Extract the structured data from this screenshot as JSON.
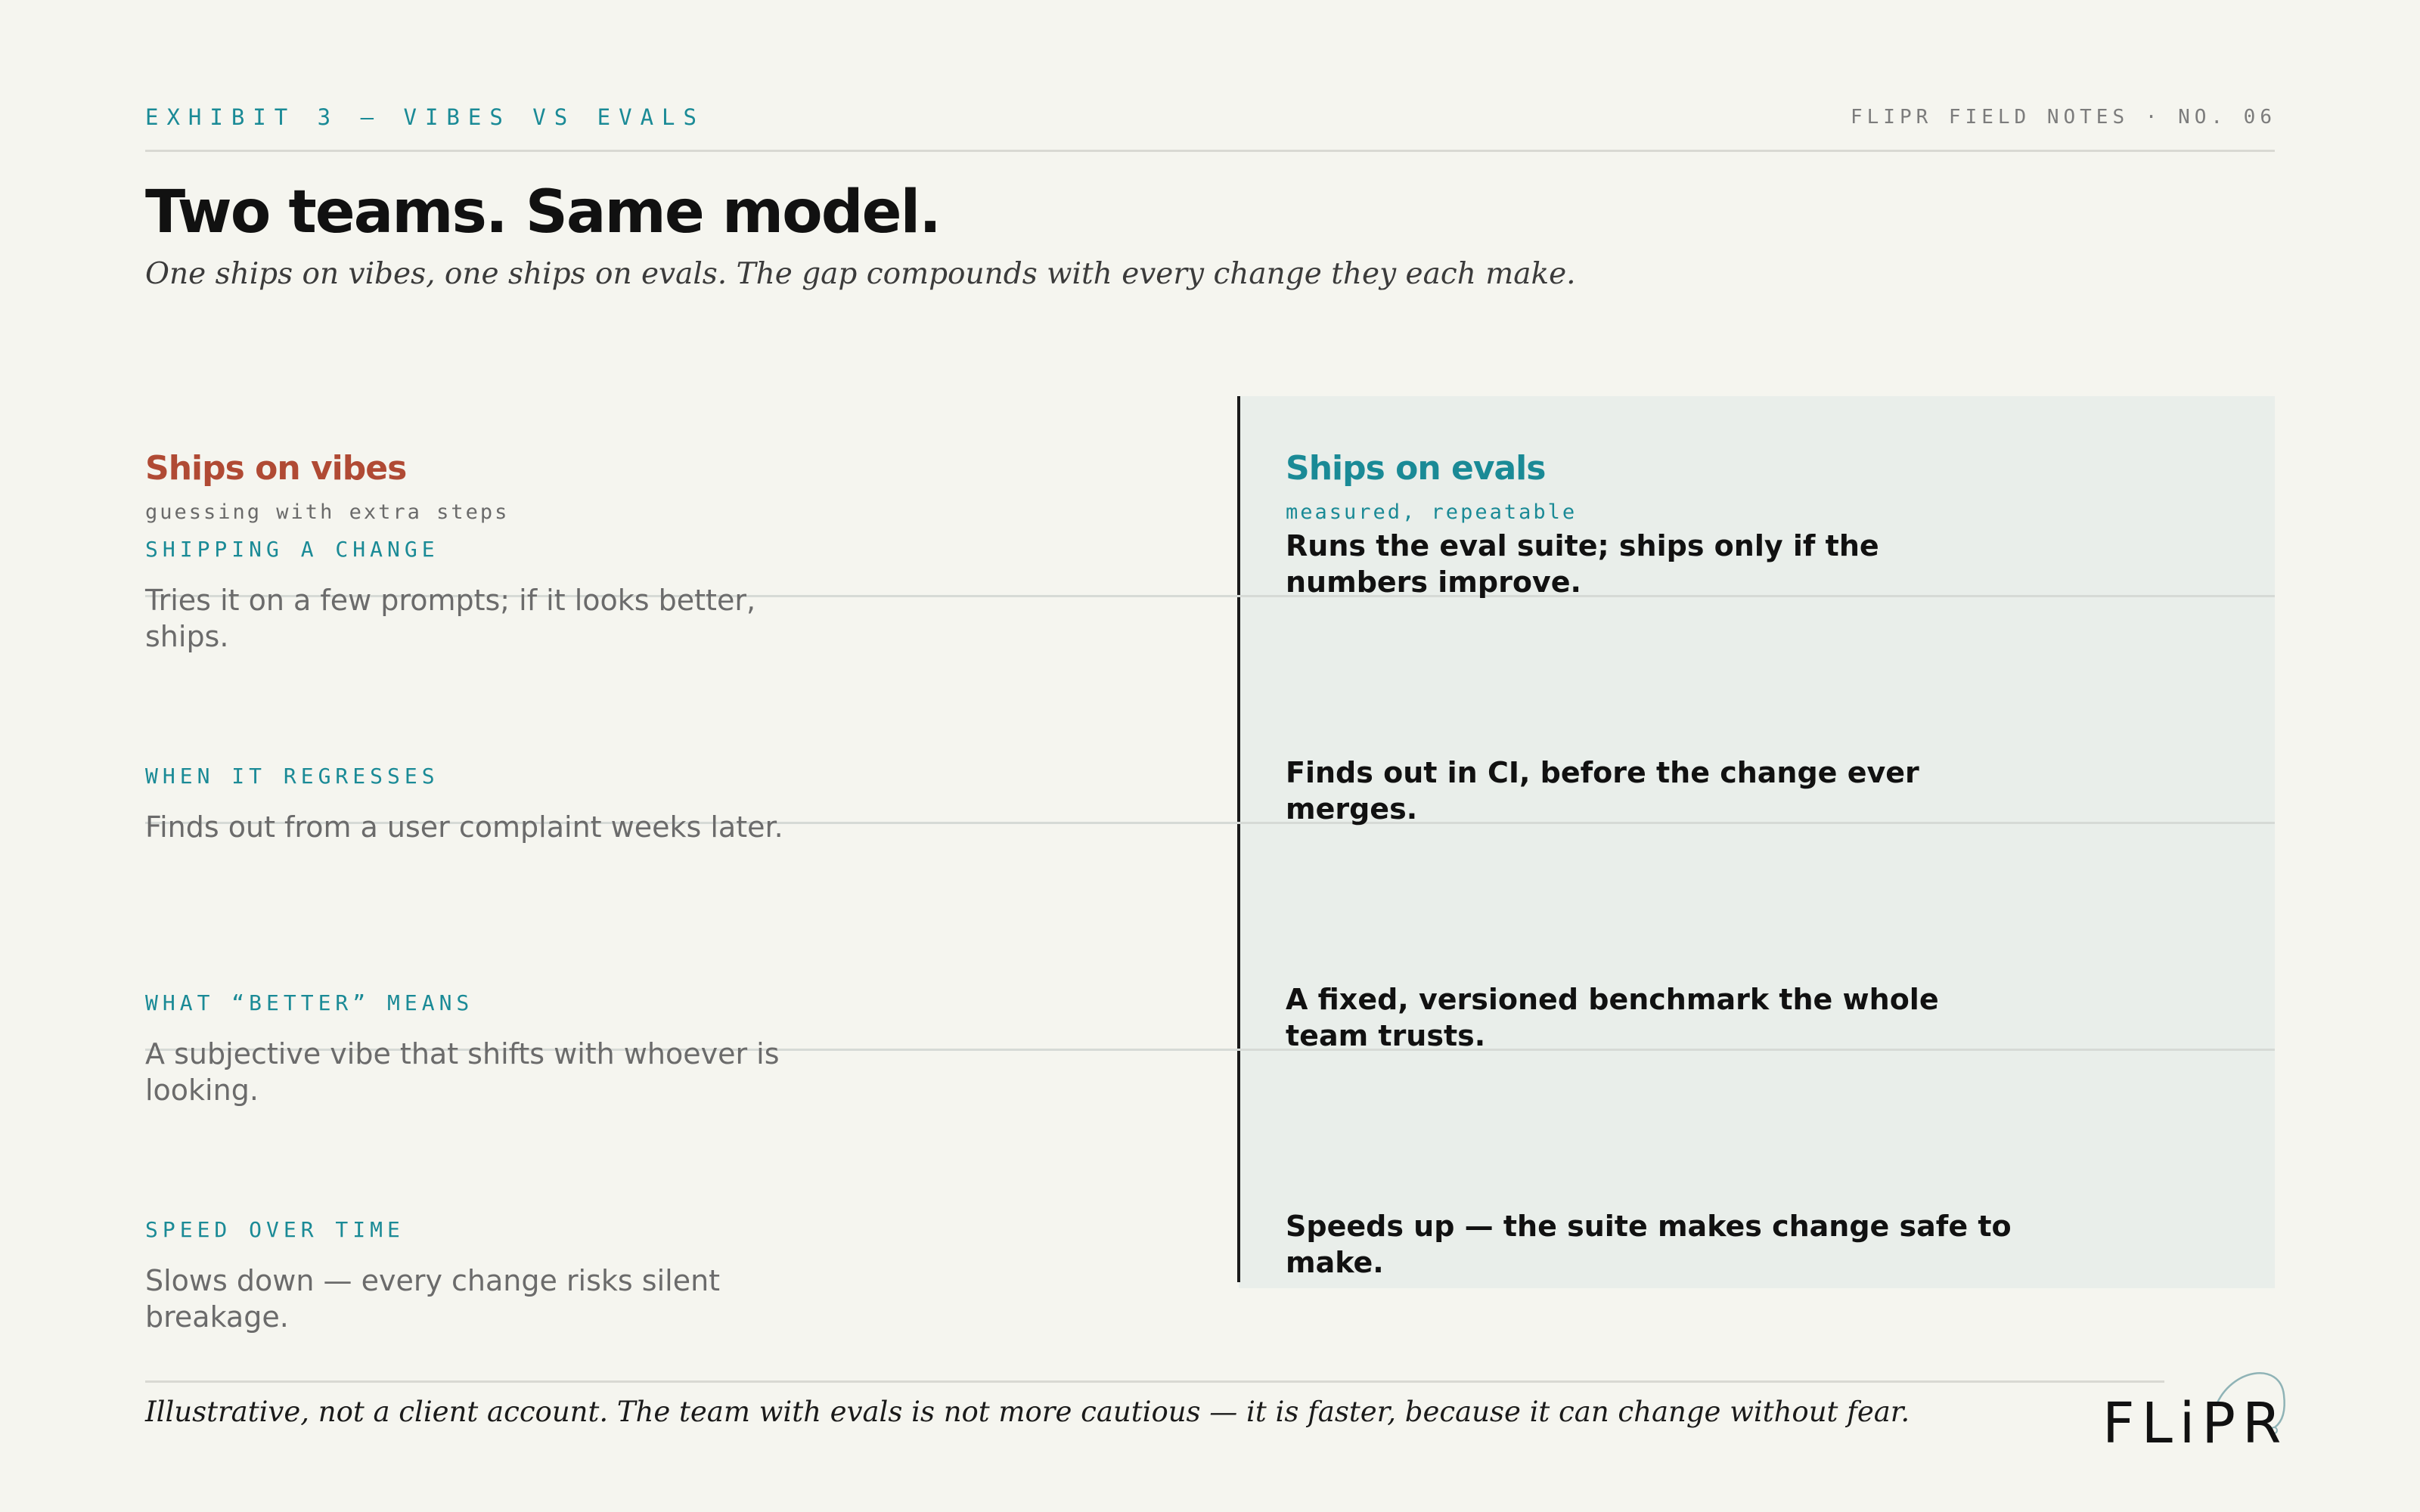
{
  "header": {
    "eyebrow": "EXHIBIT 3 — VIBES VS EVALS",
    "issue": "FLIPR FIELD NOTES · NO. 06",
    "title": "Two teams. Same model.",
    "subtitle": "One ships on vibes, one ships on evals. The gap compounds with every change they each make."
  },
  "columns": {
    "vibes": {
      "title": "Ships on vibes",
      "tag": "guessing with extra steps"
    },
    "evals": {
      "title": "Ships on evals",
      "tag": "measured, repeatable"
    }
  },
  "rows": [
    {
      "label": "SHIPPING A CHANGE",
      "vibes": "Tries it on a few prompts; if it looks better, ships.",
      "evals": "Runs the eval suite; ships only if the numbers improve."
    },
    {
      "label": "WHEN IT REGRESSES",
      "vibes": "Finds out from a user complaint weeks later.",
      "evals": "Finds out in CI, before the change ever merges."
    },
    {
      "label": "WHAT “BETTER” MEANS",
      "vibes": "A subjective vibe that shifts with whoever is looking.",
      "evals": "A fixed, versioned benchmark the whole team trusts."
    },
    {
      "label": "SPEED OVER TIME",
      "vibes": "Slows down — every change risks silent breakage.",
      "evals": "Speeds up — the suite makes change safe to make."
    }
  ],
  "footer": {
    "note": "Illustrative, not a client account. The team with evals is not more cautious — it is faster, because it can change without fear.",
    "logo": "FLiPR"
  },
  "colors": {
    "background": "#f5f5ef",
    "accent_teal": "#1a8a96",
    "accent_rust": "#b04a34",
    "evals_panel": "#e9eeea"
  }
}
